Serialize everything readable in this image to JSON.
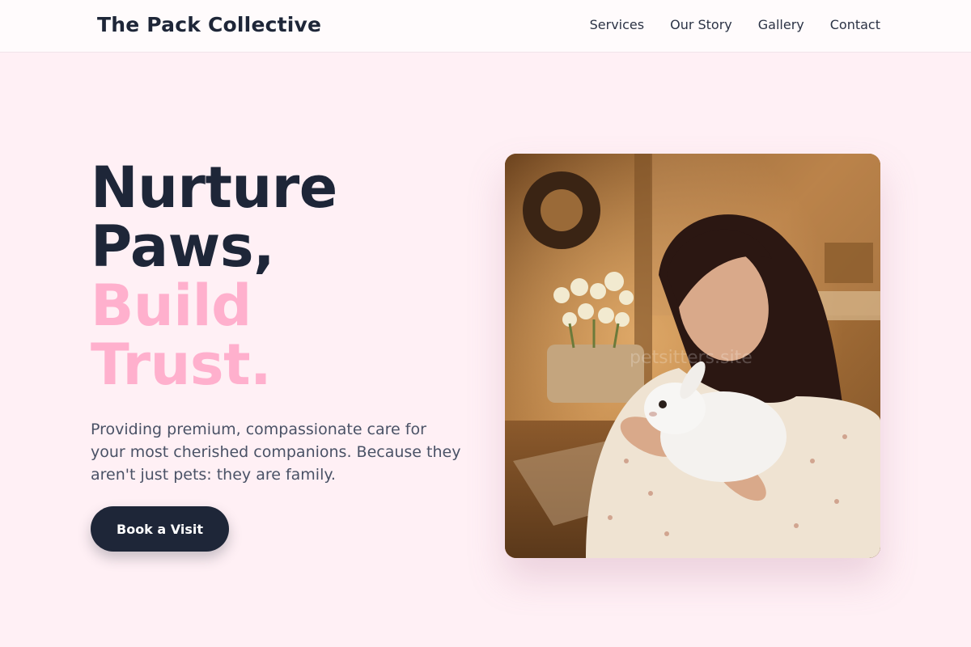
{
  "header": {
    "brand": "The Pack Collective",
    "nav": [
      "Services",
      "Our Story",
      "Gallery",
      "Contact"
    ]
  },
  "hero": {
    "headline_dark": [
      "Nurture",
      "Paws,"
    ],
    "headline_accent": [
      "Build",
      "Trust."
    ],
    "subtitle": "Providing premium, compassionate care for your most cherished companions. Because they aren't just pets: they are family.",
    "cta_label": "Book a Visit",
    "image": {
      "watermark": "petsitters.site"
    }
  },
  "colors": {
    "background": "#fff0f5",
    "dark": "#1e2638",
    "accent_pink": "#ffb0cd",
    "body_text": "#4a5266"
  }
}
